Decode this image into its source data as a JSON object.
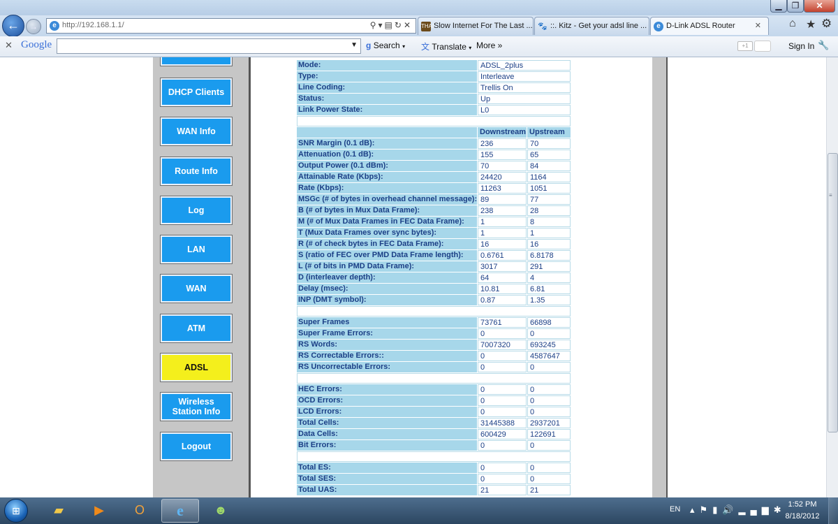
{
  "window": {
    "min_icon": "minimize-icon",
    "max_icon": "maximize-icon",
    "close_glyph": "✕"
  },
  "browser": {
    "url": "http://192.168.1.1/",
    "tabs": [
      {
        "label": "Slow Internet For The Last ...",
        "icon": "thai-site-icon",
        "icon_text": "THAI"
      },
      {
        "label": "::. Kitz - Get your adsl line ...",
        "icon": "paw-icon",
        "icon_text": "🐾"
      },
      {
        "label": "D-Link ADSL Router",
        "icon": "ie-page-icon",
        "icon_text": "e",
        "close": "✕"
      }
    ]
  },
  "google_toolbar": {
    "logo": "Google",
    "search_label": "Search",
    "translate_label": "Translate",
    "more_label": "More »",
    "plusone": "+1",
    "signin": "Sign In"
  },
  "sidebar": {
    "items": [
      {
        "label": "",
        "active": false
      },
      {
        "label": "DHCP Clients",
        "active": false
      },
      {
        "label": "WAN Info",
        "active": false
      },
      {
        "label": "Route Info",
        "active": false
      },
      {
        "label": "Log",
        "active": false
      },
      {
        "label": "LAN",
        "active": false
      },
      {
        "label": "WAN",
        "active": false
      },
      {
        "label": "ATM",
        "active": false
      },
      {
        "label": "ADSL",
        "active": true
      },
      {
        "label": "Wireless Station Info",
        "active": false
      },
      {
        "label": "Logout",
        "active": false
      }
    ]
  },
  "stats": {
    "info": [
      {
        "label": "Mode:",
        "value": "ADSL_2plus"
      },
      {
        "label": "Type:",
        "value": "Interleave"
      },
      {
        "label": "Line Coding:",
        "value": "Trellis On"
      },
      {
        "label": "Status:",
        "value": "Up"
      },
      {
        "label": "Link Power State:",
        "value": "L0"
      }
    ],
    "headers": {
      "downstream": "Downstream",
      "upstream": "Upstream"
    },
    "line": [
      {
        "label": "SNR Margin (0.1 dB):",
        "down": "236",
        "up": "70"
      },
      {
        "label": "Attenuation (0.1 dB):",
        "down": "155",
        "up": "65"
      },
      {
        "label": "Output Power (0.1 dBm):",
        "down": "70",
        "up": "84"
      },
      {
        "label": "Attainable Rate (Kbps):",
        "down": "24420",
        "up": "1164"
      },
      {
        "label": "Rate (Kbps):",
        "down": "11263",
        "up": "1051"
      },
      {
        "label": "MSGc (# of bytes in overhead channel message):",
        "down": "89",
        "up": "77"
      },
      {
        "label": "B (# of bytes in Mux Data Frame):",
        "down": "238",
        "up": "28"
      },
      {
        "label": "M (# of Mux Data Frames in FEC Data Frame):",
        "down": "1",
        "up": "8"
      },
      {
        "label": "T (Mux Data Frames over sync bytes):",
        "down": "1",
        "up": "1"
      },
      {
        "label": "R (# of check bytes in FEC Data Frame):",
        "down": "16",
        "up": "16"
      },
      {
        "label": "S (ratio of FEC over PMD Data Frame length):",
        "down": "0.6761",
        "up": "6.8178"
      },
      {
        "label": "L (# of bits in PMD Data Frame):",
        "down": "3017",
        "up": "291"
      },
      {
        "label": "D (interleaver depth):",
        "down": "64",
        "up": "4"
      },
      {
        "label": "Delay (msec):",
        "down": "10.81",
        "up": "6.81"
      },
      {
        "label": "INP (DMT symbol):",
        "down": "0.87",
        "up": "1.35"
      }
    ],
    "frames": [
      {
        "label": "Super Frames",
        "down": "73761",
        "up": "66898"
      },
      {
        "label": "Super Frame Errors:",
        "down": "0",
        "up": "0"
      },
      {
        "label": "RS Words:",
        "down": "7007320",
        "up": "693245"
      },
      {
        "label": "RS Correctable Errors::",
        "down": "0",
        "up": "4587647"
      },
      {
        "label": "RS Uncorrectable Errors:",
        "down": "0",
        "up": "0"
      }
    ],
    "cells": [
      {
        "label": "HEC Errors:",
        "down": "0",
        "up": "0"
      },
      {
        "label": "OCD Errors:",
        "down": "0",
        "up": "0"
      },
      {
        "label": "LCD Errors:",
        "down": "0",
        "up": "0"
      },
      {
        "label": "Total Cells:",
        "down": "31445388",
        "up": "2937201"
      },
      {
        "label": "Data Cells:",
        "down": "600429",
        "up": "122691"
      },
      {
        "label": "Bit Errors:",
        "down": "0",
        "up": "0"
      }
    ],
    "totals": [
      {
        "label": "Total ES:",
        "down": "0",
        "up": "0"
      },
      {
        "label": "Total SES:",
        "down": "0",
        "up": "0"
      },
      {
        "label": "Total UAS:",
        "down": "21",
        "up": "21"
      }
    ]
  },
  "taskbar": {
    "apps": [
      {
        "name": "windows-explorer-icon",
        "glyph": "▰",
        "active": false
      },
      {
        "name": "media-player-icon",
        "glyph": "▶",
        "active": false
      },
      {
        "name": "outlook-icon",
        "glyph": "O",
        "active": false
      },
      {
        "name": "internet-explorer-icon",
        "glyph": "e",
        "active": true
      },
      {
        "name": "people-icon",
        "glyph": "☻",
        "active": false
      }
    ],
    "lang": "EN",
    "time": "1:52 PM",
    "date": "8/18/2012"
  },
  "colors": {
    "menu_button": "#1a9bee",
    "menu_active": "#f4ef1c",
    "table_label_bg": "#a7d7ea",
    "table_text": "#1b3f86",
    "sidebar_bg": "#c6c6c6"
  }
}
